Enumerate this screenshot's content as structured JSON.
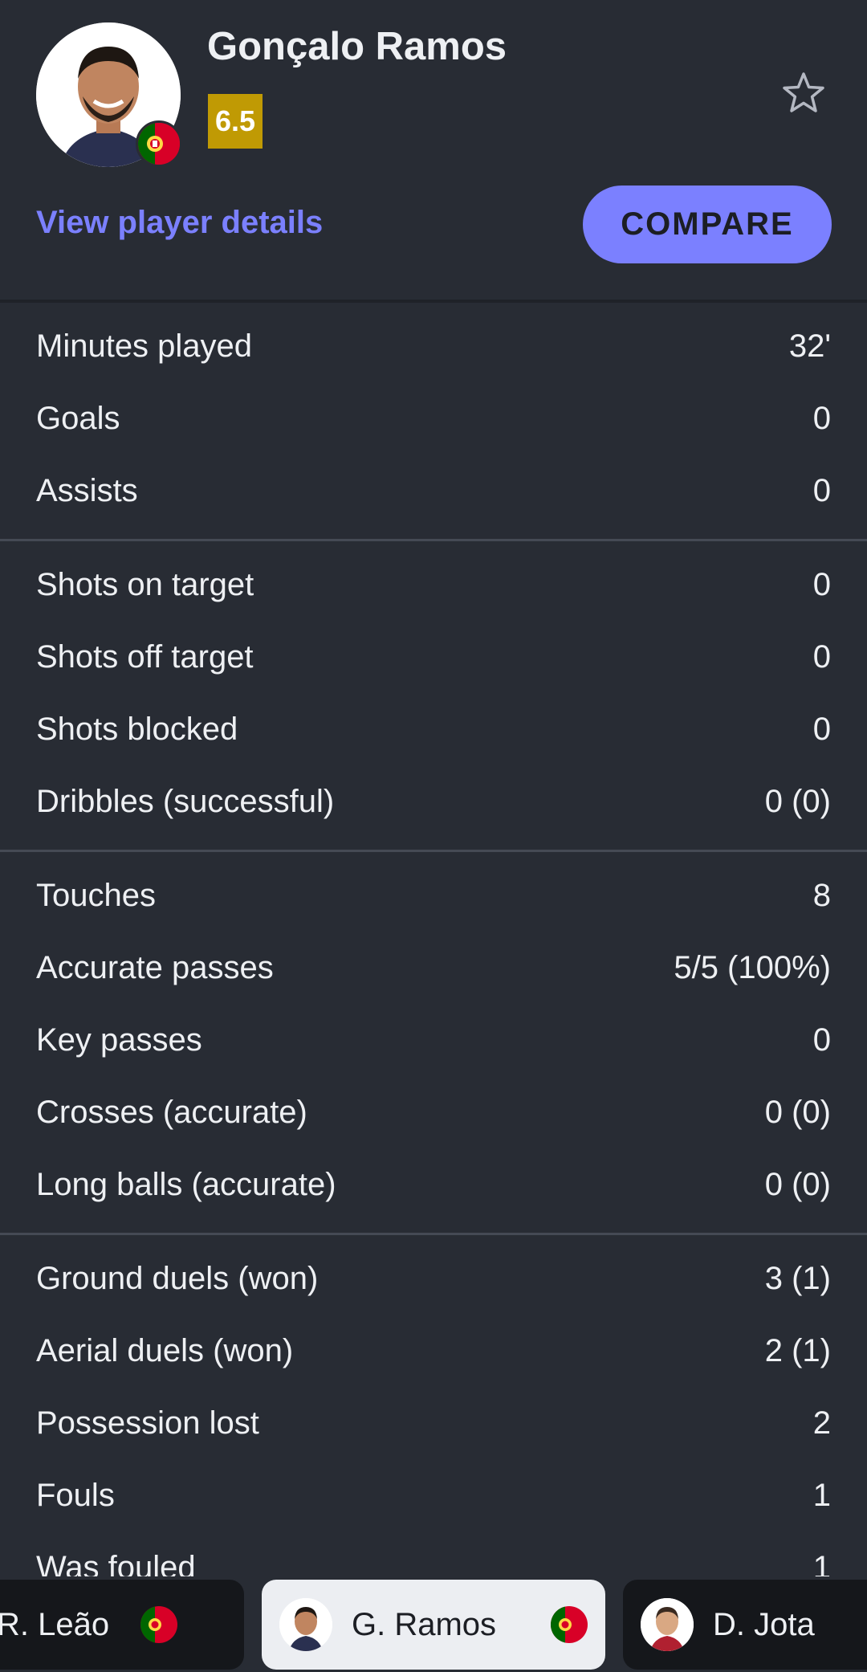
{
  "header": {
    "player_name": "Gonçalo Ramos",
    "rating": "6.5",
    "rating_color": "#c09a04",
    "view_details_label": "View player details",
    "compare_label": "COMPARE",
    "accent_color": "#7b80ff",
    "flag_icon": "portugal-flag-icon",
    "favorite_icon": "star-outline-icon"
  },
  "stat_groups": [
    {
      "rows": [
        {
          "label": "Minutes played",
          "value": "32'"
        },
        {
          "label": "Goals",
          "value": "0"
        },
        {
          "label": "Assists",
          "value": "0"
        }
      ]
    },
    {
      "rows": [
        {
          "label": "Shots on target",
          "value": "0"
        },
        {
          "label": "Shots off target",
          "value": "0"
        },
        {
          "label": "Shots blocked",
          "value": "0"
        },
        {
          "label": "Dribbles (successful)",
          "value": "0 (0)"
        }
      ]
    },
    {
      "rows": [
        {
          "label": "Touches",
          "value": "8"
        },
        {
          "label": "Accurate passes",
          "value": "5/5 (100%)"
        },
        {
          "label": "Key passes",
          "value": "0"
        },
        {
          "label": "Crosses (accurate)",
          "value": "0 (0)"
        },
        {
          "label": "Long balls (accurate)",
          "value": "0 (0)"
        }
      ]
    },
    {
      "rows": [
        {
          "label": "Ground duels (won)",
          "value": "3 (1)"
        },
        {
          "label": "Aerial duels (won)",
          "value": "2 (1)"
        },
        {
          "label": "Possession lost",
          "value": "2"
        },
        {
          "label": "Fouls",
          "value": "1"
        },
        {
          "label": "Was fouled",
          "value": "1"
        }
      ]
    }
  ],
  "carousel": {
    "prev_player": "R. Leão",
    "current_player": "G. Ramos",
    "next_player": "D. Jota"
  }
}
